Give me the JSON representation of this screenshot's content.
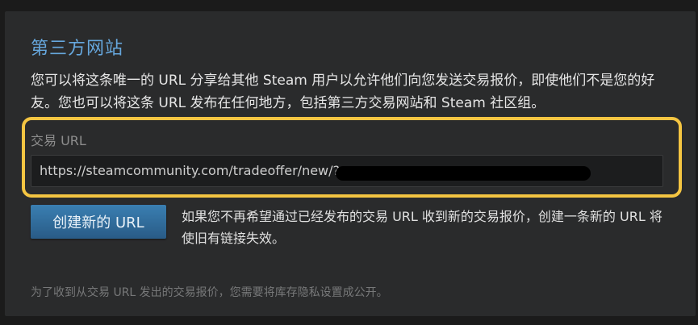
{
  "section": {
    "title": "第三方网站",
    "description": "您可以将这条唯一的 URL 分享给其他 Steam 用户以允许他们向您发送交易报价，即使他们不是您的好友。您也可以将这条 URL 发布在任何地方，包括第三方交易网站和 Steam 社区组。"
  },
  "trade_url": {
    "label": "交易 URL",
    "value": "https://steamcommunity.com/tradeoffer/new/?"
  },
  "create_button": {
    "label": "创建新的 URL",
    "description": "如果您不再希望通过已经发布的交易 URL 收到新的交易报价，创建一条新的 URL 将使旧有链接失效。"
  },
  "footnote": "为了收到从交易 URL 发出的交易报价，您需要将库存隐私设置成公开。",
  "colors": {
    "title": "#66a7dd",
    "highlight": "#f4c542",
    "button": "#2f6a98",
    "panel": "#2a2b2c"
  }
}
